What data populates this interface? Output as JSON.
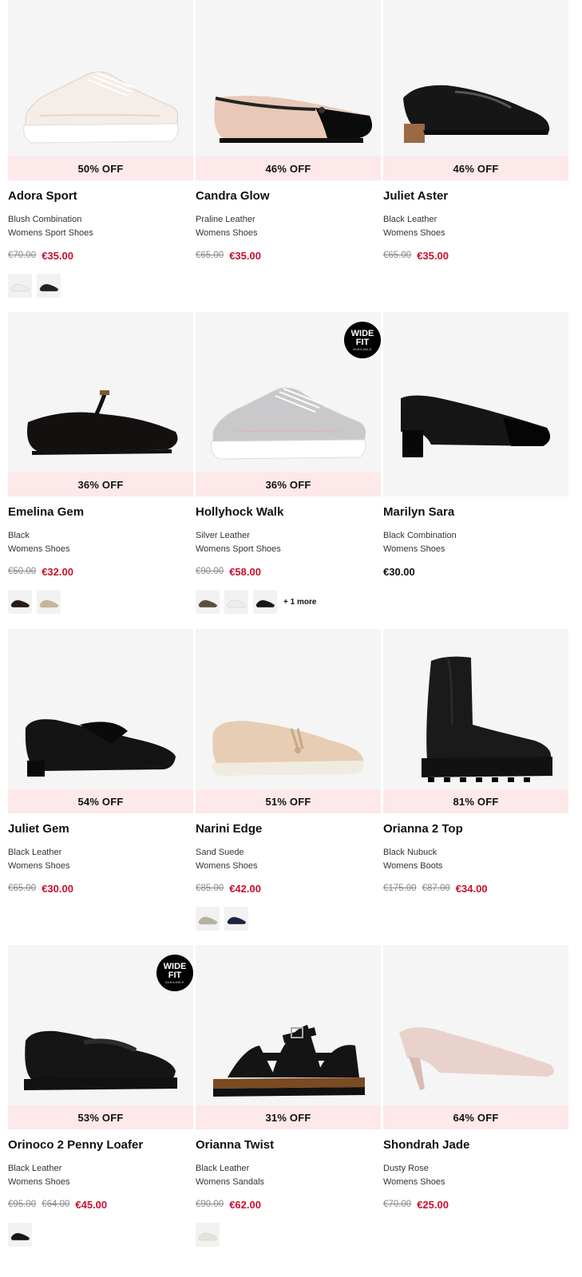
{
  "products": [
    {
      "name": "Adora Sport",
      "colour": "Blush Combination",
      "category": "Womens Sport Shoes",
      "discount": "50% OFF",
      "was": "€70.00",
      "was2": "",
      "now": "€35.00",
      "regular": "",
      "badge": false,
      "shoe": "sneaker",
      "shoe_color": "#f4ede8",
      "sole_color": "#ffffff",
      "swatches": [
        "#f0ebe6",
        "#222222"
      ],
      "more": ""
    },
    {
      "name": "Candra Glow",
      "colour": "Praline Leather",
      "category": "Womens Shoes",
      "discount": "46% OFF",
      "was": "€65.00",
      "was2": "",
      "now": "€35.00",
      "regular": "",
      "badge": false,
      "shoe": "ballet",
      "shoe_color": "#e8c9b8",
      "sole_color": "#111111",
      "swatches": [],
      "more": ""
    },
    {
      "name": "Juliet Aster",
      "colour": "Black Leather",
      "category": "Womens Shoes",
      "discount": "46% OFF",
      "was": "€65.00",
      "was2": "",
      "now": "€35.00",
      "regular": "",
      "badge": false,
      "shoe": "loafer-heel",
      "shoe_color": "#161616",
      "sole_color": "#9b6a45",
      "swatches": [],
      "more": ""
    },
    {
      "name": "Emelina Gem",
      "colour": "Black",
      "category": "Womens Shoes",
      "discount": "36% OFF",
      "was": "€50.00",
      "was2": "",
      "now": "€32.00",
      "regular": "",
      "badge": false,
      "shoe": "maryjane",
      "shoe_color": "#141010",
      "sole_color": "#111111",
      "swatches": [
        "#2a1a14",
        "#c9b49a"
      ],
      "more": ""
    },
    {
      "name": "Hollyhock Walk",
      "colour": "Silver Leather",
      "category": "Womens Sport Shoes",
      "discount": "36% OFF",
      "was": "€90.00",
      "was2": "",
      "now": "€58.00",
      "regular": "",
      "badge": true,
      "shoe": "sneaker",
      "shoe_color": "#c9c9cc",
      "sole_color": "#ffffff",
      "swatches": [
        "#5a5040",
        "#eeeeee",
        "#151515"
      ],
      "more": "+ 1 more"
    },
    {
      "name": "Marilyn Sara",
      "colour": "Black Combination",
      "category": "Womens Shoes",
      "discount": "",
      "was": "",
      "was2": "",
      "now": "",
      "regular": "€30.00",
      "badge": false,
      "shoe": "pump-block",
      "shoe_color": "#151515",
      "sole_color": "#000000",
      "swatches": [],
      "more": ""
    },
    {
      "name": "Juliet Gem",
      "colour": "Black Leather",
      "category": "Womens Shoes",
      "discount": "54% OFF",
      "was": "€65.00",
      "was2": "",
      "now": "€30.00",
      "regular": "",
      "badge": false,
      "shoe": "slipon",
      "shoe_color": "#141414",
      "sole_color": "#111111",
      "swatches": [],
      "more": ""
    },
    {
      "name": "Narini Edge",
      "colour": "Sand Suede",
      "category": "Womens Shoes",
      "discount": "51% OFF",
      "was": "€85.00",
      "was2": "",
      "now": "€42.00",
      "regular": "",
      "badge": false,
      "shoe": "tassel",
      "shoe_color": "#e6cdb3",
      "sole_color": "#f0ebe0",
      "swatches": [
        "#b8b0a0",
        "#1c2340"
      ],
      "more": ""
    },
    {
      "name": "Orianna 2 Top",
      "colour": "Black Nubuck",
      "category": "Womens Boots",
      "discount": "81% OFF",
      "was": "€175.00",
      "was2": "€87.00",
      "now": "€34.00",
      "regular": "",
      "badge": false,
      "shoe": "boot",
      "shoe_color": "#1a1a1a",
      "sole_color": "#111111",
      "swatches": [],
      "more": ""
    },
    {
      "name": "Orinoco 2 Penny Loafer",
      "colour": "Black Leather",
      "category": "Womens Shoes",
      "discount": "53% OFF",
      "was": "€95.00",
      "was2": "€64.00",
      "now": "€45.00",
      "regular": "",
      "badge": true,
      "shoe": "penny",
      "shoe_color": "#151515",
      "sole_color": "#111111",
      "swatches": [
        "#151515"
      ],
      "more": ""
    },
    {
      "name": "Orianna Twist",
      "colour": "Black Leather",
      "category": "Womens Sandals",
      "discount": "31% OFF",
      "was": "€90.00",
      "was2": "",
      "now": "€62.00",
      "regular": "",
      "badge": false,
      "shoe": "sandal",
      "shoe_color": "#141414",
      "sole_color": "#7a4a22",
      "swatches": [
        "#e8e2d8"
      ],
      "more": ""
    },
    {
      "name": "Shondrah Jade",
      "colour": "Dusty Rose",
      "category": "Womens Shoes",
      "discount": "64% OFF",
      "was": "€70.00",
      "was2": "",
      "now": "€25.00",
      "regular": "",
      "badge": false,
      "shoe": "kitten",
      "shoe_color": "#ead2cc",
      "sole_color": "#d9bcb3",
      "swatches": [],
      "more": ""
    }
  ],
  "badge_text": {
    "line1": "WIDE",
    "line2": "FIT",
    "line3": "AVAILABLE"
  }
}
